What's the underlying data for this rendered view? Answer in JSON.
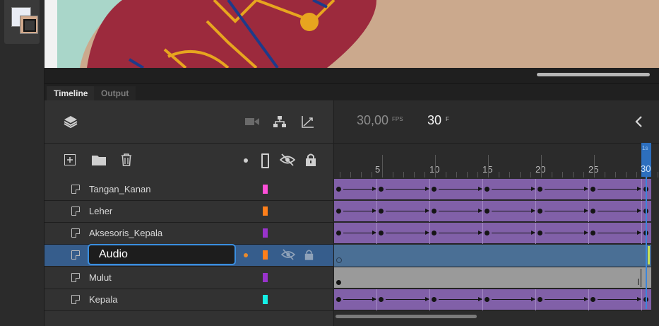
{
  "tabs": {
    "timeline": "Timeline",
    "output": "Output"
  },
  "header": {
    "fps_value": "30,00",
    "fps_unit": "FPS",
    "frame_value": "30",
    "frame_unit": "F"
  },
  "ruler": {
    "labels": [
      "5",
      "10",
      "15",
      "20",
      "25"
    ],
    "current_frame": "30",
    "marker_top": "1s"
  },
  "layers": [
    {
      "name": "Tangan_Kanan",
      "color": "#ff4fd8"
    },
    {
      "name": "Leher",
      "color": "#ff7f1a"
    },
    {
      "name": "Aksesoris_Kepala",
      "color": "#9933cc"
    },
    {
      "name": "Audio",
      "color": "#ff7f1a"
    },
    {
      "name": "Mulut",
      "color": "#9933cc"
    },
    {
      "name": "Kepala",
      "color": "#14f0e6"
    }
  ],
  "rename_value": "Audio",
  "icons": {
    "layers": "layers-icon",
    "camera": "camera-icon",
    "hierarchy": "hierarchy-icon",
    "graph": "graph-icon",
    "back": "chevron-left-icon",
    "add": "add-layer-icon",
    "folder": "folder-icon",
    "delete": "trash-icon",
    "dot": "highlight-dot-icon",
    "outline": "outline-icon",
    "eye": "hide-icon",
    "lock": "lock-icon"
  },
  "colors": {
    "selected_row": "#365d8c",
    "frame_purple": "#8160a8",
    "playhead": "#2d6fbe"
  }
}
